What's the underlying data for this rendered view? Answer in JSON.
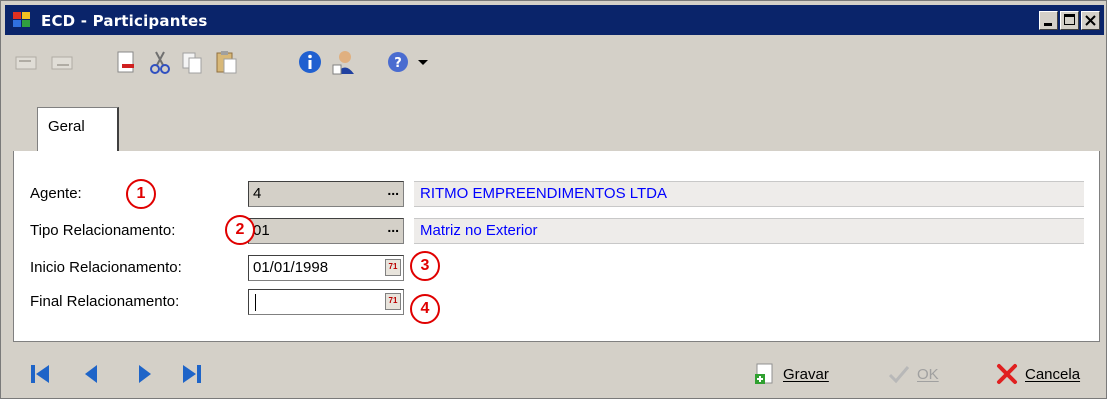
{
  "window": {
    "title": "ECD - Participantes"
  },
  "toolbar": {
    "icons": [
      "undo-icon",
      "redo-icon",
      "new-document-icon",
      "cut-icon",
      "copy-icon",
      "paste-icon",
      "info-icon",
      "user-icon",
      "help-icon",
      "dropdown-arrow-icon"
    ]
  },
  "tabs": [
    {
      "label": "Geral"
    }
  ],
  "form": {
    "agente": {
      "label": "Agente:",
      "code": "4",
      "description": "RITMO EMPREENDIMENTOS LTDA",
      "marker": "1"
    },
    "tipo": {
      "label": "Tipo Relacionamento:",
      "code": "01",
      "description": "Matriz no Exterior",
      "marker": "2"
    },
    "inicio": {
      "label": "Inicio Relacionamento:",
      "value": "01/01/1998",
      "marker": "3"
    },
    "final": {
      "label": "Final Relacionamento:",
      "value": "",
      "marker": "4"
    },
    "ellipsis": "..."
  },
  "actions": {
    "save": "Gravar",
    "ok": "OK",
    "cancel": "Cancela"
  },
  "colors": {
    "title_bar": "#0a246a",
    "link_text": "#0000ff",
    "marker": "#e00000",
    "nav_arrow": "#1e64c8"
  }
}
